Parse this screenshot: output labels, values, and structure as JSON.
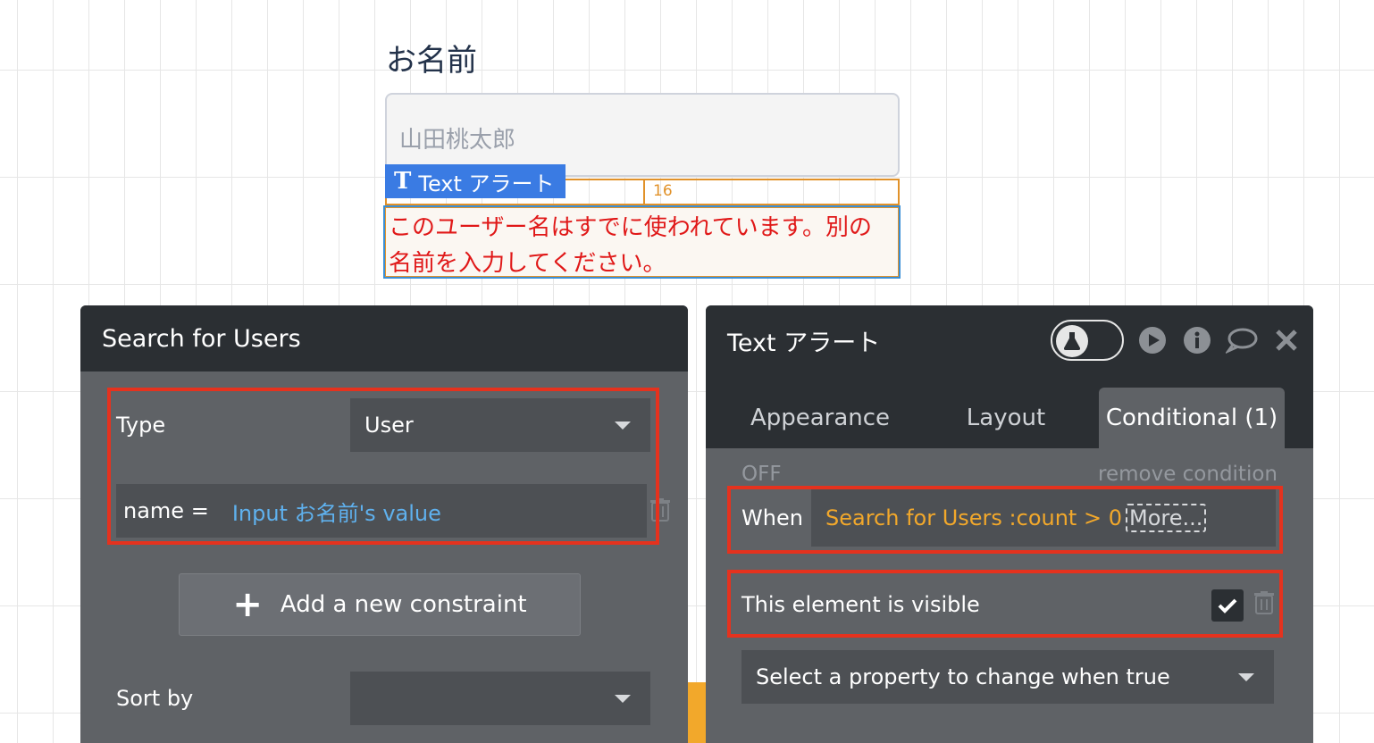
{
  "canvas": {
    "label": "お名前",
    "input_placeholder": "山田桃太郎",
    "selected_element_tag": "Text アラート",
    "dimension_value": "16",
    "alert_text": "このユーザー名はすでに使われています。別の名前を入力してください。"
  },
  "search_panel": {
    "title": "Search for Users",
    "type_label": "Type",
    "type_value": "User",
    "constraint_field": "name =",
    "constraint_expression": "Input お名前's value",
    "add_constraint_label": "Add a new constraint",
    "sort_by_label": "Sort by",
    "sort_by_value": ""
  },
  "element_panel": {
    "title": "Text アラート",
    "tabs": [
      {
        "label": "Appearance"
      },
      {
        "label": "Layout"
      },
      {
        "label": "Conditional (1)"
      }
    ],
    "status_off": "OFF",
    "remove_condition": "remove condition",
    "when_label": "When",
    "when_expression": "Search for Users :count  >  0",
    "more_label": "More...",
    "visible_property": "This element is visible",
    "visible_checked": true,
    "select_property_placeholder": "Select a property to change when true"
  },
  "colors": {
    "panel_header": "#2b2f33",
    "panel_body": "#5f6266",
    "field_bg": "#4d5054",
    "highlight_red": "#e5321e",
    "expression_blue": "#5fb1ee",
    "expression_orange": "#f2a82b",
    "alert_text_red": "#e01818",
    "selection_blue": "#3a7be3"
  }
}
